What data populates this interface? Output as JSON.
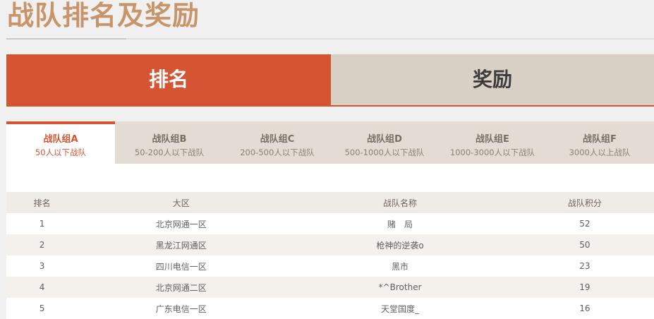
{
  "page": {
    "title": "战队排名及奖励"
  },
  "main_tabs": [
    {
      "label": "排名",
      "active": true
    },
    {
      "label": "奖励",
      "active": false
    }
  ],
  "group_tabs": [
    {
      "name": "战队组A",
      "desc": "50人以下战队",
      "active": true
    },
    {
      "name": "战队组B",
      "desc": "50-200人以下战队",
      "active": false
    },
    {
      "name": "战队组C",
      "desc": "200-500人以下战队",
      "active": false
    },
    {
      "name": "战队组D",
      "desc": "500-1000人以下战队",
      "active": false
    },
    {
      "name": "战队组E",
      "desc": "1000-3000人以下战队",
      "active": false
    },
    {
      "name": "战队组F",
      "desc": "3000人以上战队",
      "active": false
    }
  ],
  "table": {
    "headers": {
      "rank": "排名",
      "region": "大区",
      "team": "战队名称",
      "score": "战队积分"
    },
    "rows": [
      {
        "rank": "1",
        "region": "北京网通一区",
        "team": "赌　局",
        "score": "52"
      },
      {
        "rank": "2",
        "region": "黑龙江网通区",
        "team": "枪神的逆袭o",
        "score": "50"
      },
      {
        "rank": "3",
        "region": "四川电信一区",
        "team": "黑市",
        "score": "23"
      },
      {
        "rank": "4",
        "region": "北京网通二区",
        "team": "*^Brother",
        "score": "19"
      },
      {
        "rank": "5",
        "region": "广东电信一区",
        "team": "天堂国度_",
        "score": "16"
      }
    ]
  },
  "colors": {
    "accent": "#d55432",
    "title": "#c8956a",
    "inactive_tab": "#d8cfc5"
  }
}
